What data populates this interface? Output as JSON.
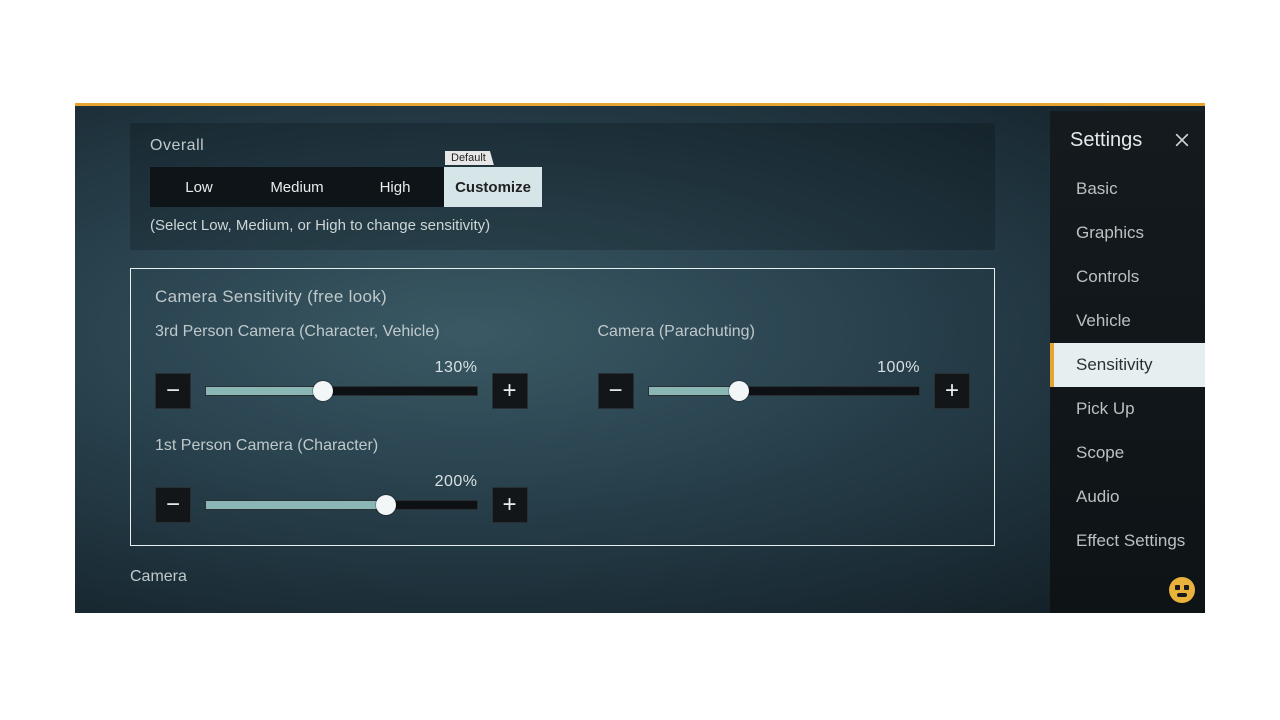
{
  "sidebar": {
    "title": "Settings",
    "items": [
      {
        "label": "Basic"
      },
      {
        "label": "Graphics"
      },
      {
        "label": "Controls"
      },
      {
        "label": "Vehicle"
      },
      {
        "label": "Sensitivity",
        "active": true
      },
      {
        "label": "Pick Up"
      },
      {
        "label": "Scope"
      },
      {
        "label": "Audio"
      },
      {
        "label": "Effect Settings"
      }
    ]
  },
  "overall": {
    "title": "Overall",
    "default_badge": "Default",
    "presets": [
      {
        "label": "Low"
      },
      {
        "label": "Medium"
      },
      {
        "label": "High"
      },
      {
        "label": "Customize",
        "active": true
      }
    ],
    "hint": "(Select Low, Medium, or High to change sensitivity)"
  },
  "camera_free_look": {
    "title": "Camera Sensitivity (free look)",
    "sliders": {
      "tpp": {
        "label": "3rd Person Camera (Character, Vehicle)",
        "value_text": "130%",
        "value": 130,
        "max": 300
      },
      "parachute": {
        "label": "Camera (Parachuting)",
        "value_text": "100%",
        "value": 100,
        "max": 300
      },
      "fpp": {
        "label": "1st Person Camera (Character)",
        "value_text": "200%",
        "value": 200,
        "max": 300
      }
    }
  },
  "next_section": {
    "title": "Camera"
  },
  "glyphs": {
    "minus": "−",
    "plus": "+"
  }
}
